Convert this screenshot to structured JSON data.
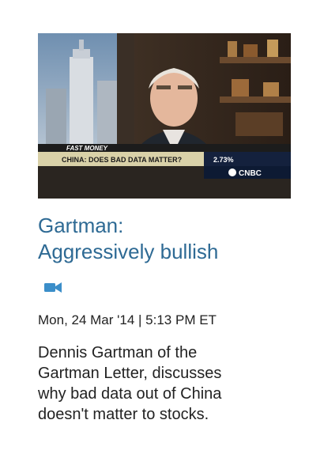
{
  "article": {
    "thumbnail": {
      "ticker_label": "FAST MONEY",
      "chyron": "CHINA: DOES BAD DATA MATTER?",
      "chyron_value": "2.73%",
      "network": "CNBC"
    },
    "title_lines": [
      "Gartman:",
      "Aggressively bullish"
    ],
    "media_type_icon": "video-camera-icon",
    "dateline": "Mon, 24 Mar '14 | 5:13 PM ET",
    "description_lines": [
      "Dennis Gartman of the",
      "Gartman Letter, discusses",
      "why bad data out of China",
      "doesn't matter to stocks."
    ]
  },
  "colors": {
    "headline": "#2e6a94",
    "camera_icon": "#3b8ec9",
    "body_text": "#222222"
  }
}
